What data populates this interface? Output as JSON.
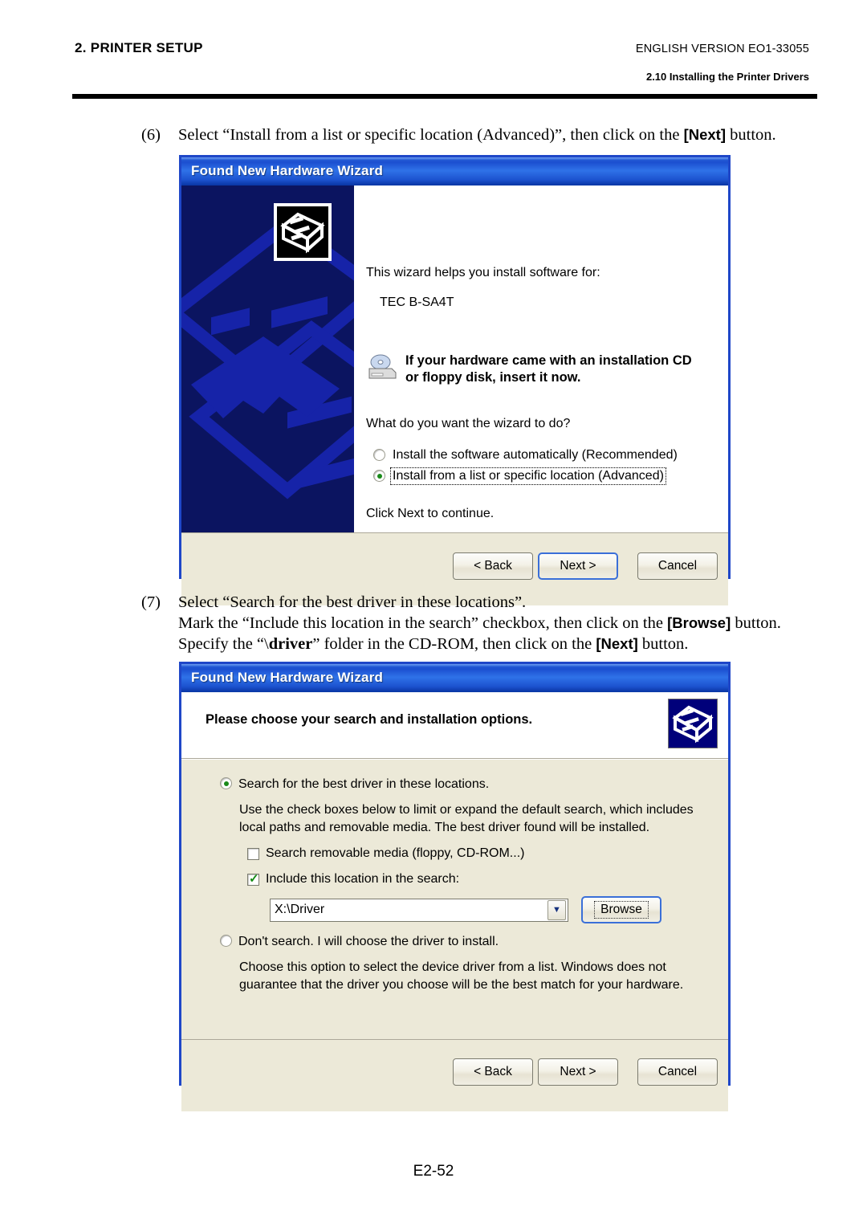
{
  "header": {
    "left_title": "2. PRINTER SETUP",
    "right_version": "ENGLISH VERSION EO1-33055",
    "right_section": "2.10 Installing the Printer Drivers"
  },
  "steps": {
    "step6": {
      "number": "(6)",
      "text_before": "Select “Install from a list or specific location (Advanced)”, then click on the ",
      "bold_token": "[Next]",
      "text_after": " button."
    },
    "step7": {
      "number": "(7)",
      "line1": "Select “Search for the best driver in these locations”.",
      "line2_before": "Mark the “Include this location in the search” checkbox, then click on the ",
      "line2_bold": "[Browse]",
      "line2_after": " button.",
      "line3_before": "Specify the “\\",
      "line3_bold_inline": "driver",
      "line3_mid": "” folder in the CD-ROM, then click on the ",
      "line3_bold": "[Next]",
      "line3_after": " button."
    }
  },
  "dialog1": {
    "title": "Found New Hardware Wizard",
    "help_line": "This wizard helps you install software for:",
    "device_name": "TEC B-SA4T",
    "cd_notice_line1": "If your hardware came with an installation CD",
    "cd_notice_line2": "or floppy disk, insert it now.",
    "question": "What do you want the wizard to do?",
    "options": [
      {
        "label": "Install the software automatically (Recommended)",
        "selected": false,
        "focused": false
      },
      {
        "label": "Install from a list or specific location (Advanced)",
        "selected": true,
        "focused": true
      }
    ],
    "click_next": "Click Next to continue.",
    "buttons": {
      "back": "< Back",
      "next": "Next >",
      "cancel": "Cancel"
    }
  },
  "dialog2": {
    "title": "Found New Hardware Wizard",
    "heading": "Please choose your search and installation options.",
    "option1": {
      "label": "Search for the best driver in these locations.",
      "selected": true,
      "description": "Use the check boxes below to limit or expand the default search, which includes local paths and removable media. The best driver found will be installed."
    },
    "checkboxes": [
      {
        "label": "Search removable media (floppy, CD-ROM...)",
        "checked": false
      },
      {
        "label": "Include this location in the search:",
        "checked": true
      }
    ],
    "location_combo": {
      "value": "X:\\Driver",
      "arrow": "▼"
    },
    "browse_button": "Browse",
    "option2": {
      "label": "Don't search.  I will choose the driver to install.",
      "selected": false,
      "description": "Choose this option to select the device driver from a list.  Windows does not guarantee that the driver you choose will be the best match for your hardware."
    },
    "buttons": {
      "back": "< Back",
      "next": "Next >",
      "cancel": "Cancel"
    }
  },
  "page_footer": "E2-52",
  "colors": {
    "title_blue": "#1f47c8",
    "dialog_face": "#ece9d8",
    "panel_navy": "#0b1460",
    "panel_iso_blue": "#1623a8",
    "radio_green": "#1a8a1a",
    "check_green": "#128a12"
  }
}
